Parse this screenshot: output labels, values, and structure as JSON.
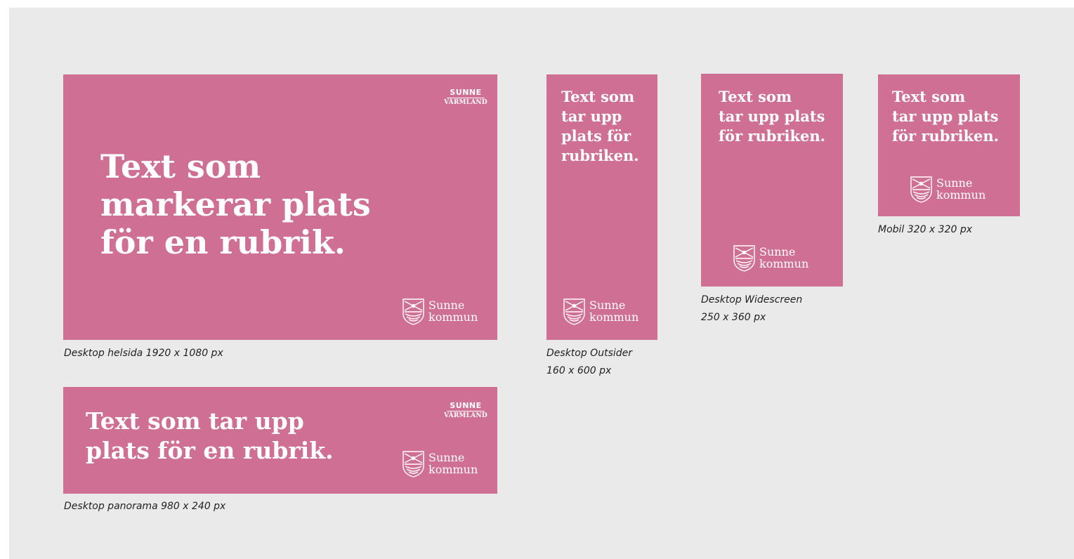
{
  "brand": {
    "banner_color": "#d06f94",
    "background_color": "#eaeaea",
    "text_color": "#ffffff",
    "region_logo": {
      "line1": "SUNNE",
      "line2": "VÄRMLAND"
    },
    "municipality_logo": {
      "line1": "Sunne",
      "line2": "kommun",
      "icon": "coat-of-arms-icon"
    }
  },
  "banners": {
    "helsida": {
      "headline": "Text som\nmarkerar plats\nför en rubrik.",
      "caption": "Desktop helsida 1920 x 1080 px"
    },
    "panorama": {
      "headline": "Text som tar upp\nplats för en rubrik.",
      "caption": "Desktop panorama 980 x 240 px"
    },
    "outsider": {
      "headline": "Text som\ntar upp\nplats för\nrubriken.",
      "caption": "Desktop Outsider\n160 x 600 px"
    },
    "widescreen": {
      "headline": "Text som\ntar upp plats\nför rubriken.",
      "caption": "Desktop Widescreen\n250 x 360 px"
    },
    "mobil": {
      "headline": "Text som\ntar upp plats\nför rubriken.",
      "caption": "Mobil 320 x 320 px"
    }
  }
}
